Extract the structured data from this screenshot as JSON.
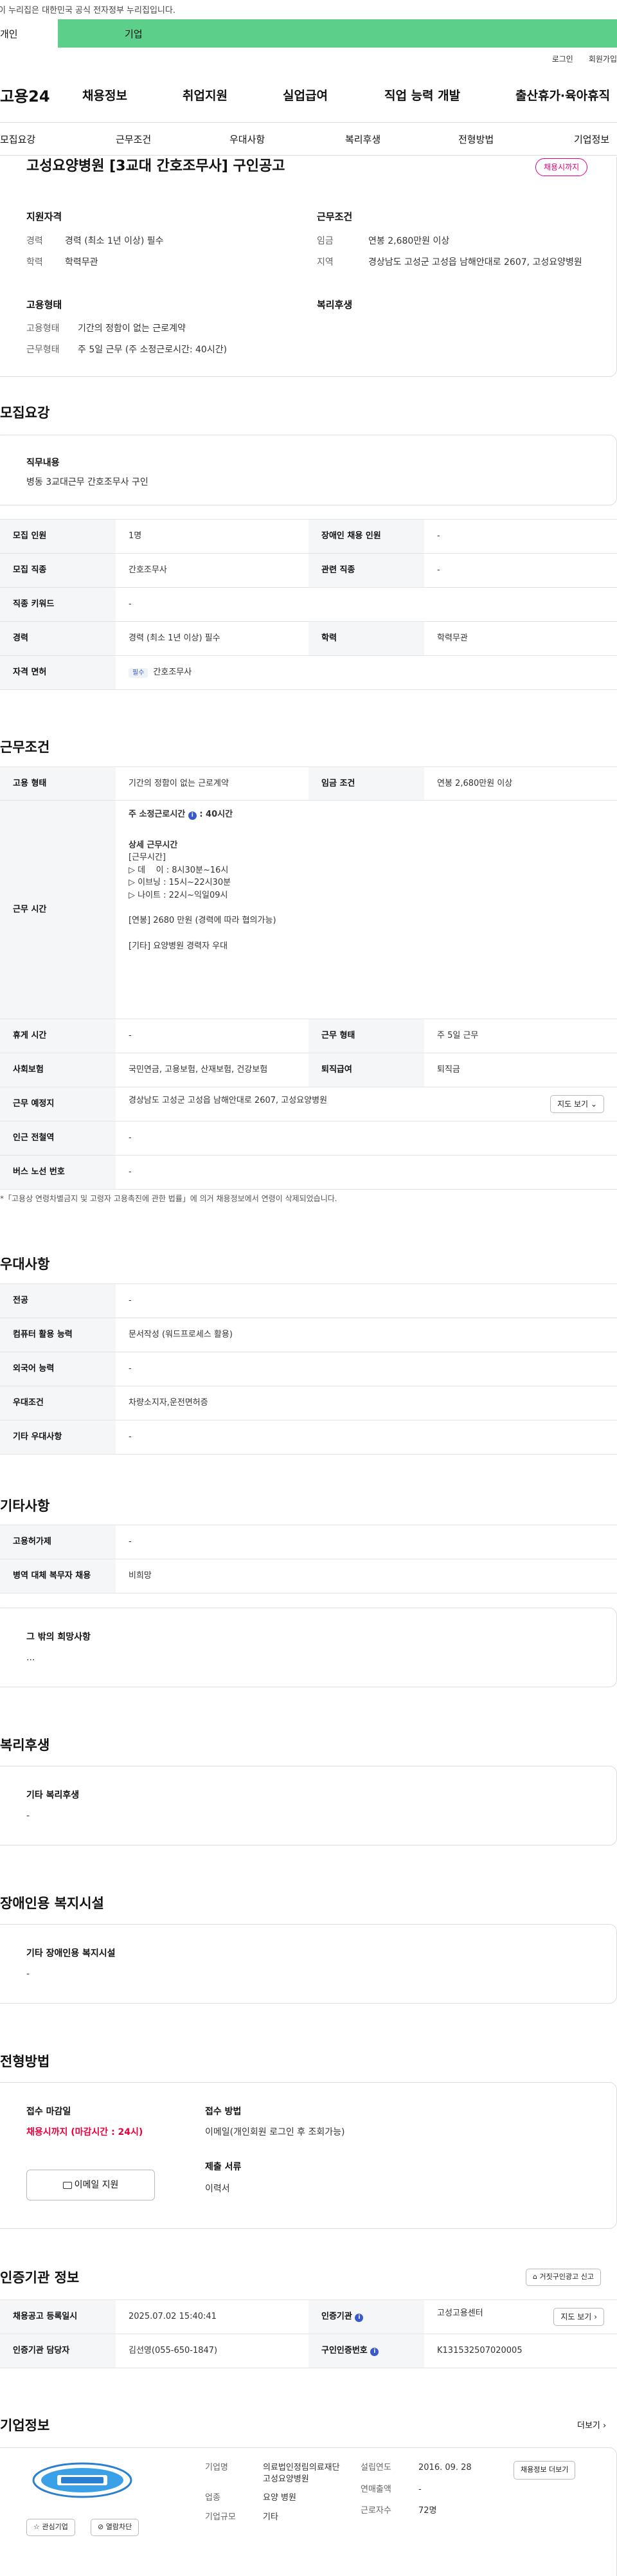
{
  "gov_banner": "이 누리집은 대한민국 공식 전자정부 누리집입니다.",
  "tabs": {
    "individual": "개인",
    "company": "기업"
  },
  "util": {
    "login": "로그인",
    "join": "회원가입"
  },
  "site": {
    "logo": "고용24"
  },
  "gnb": [
    "채용정보",
    "취업지원",
    "실업급여",
    "직업 능력 개발",
    "출산휴가·육아휴직"
  ],
  "anchors": [
    "모집요강",
    "근무조건",
    "우대사항",
    "복리후생",
    "전형방법",
    "기업정보"
  ],
  "job": {
    "title": "고성요양병원 [3교대 간호조무사] 구인공고",
    "status_badge": "채용시까지",
    "qual_title": "지원자격",
    "qual": [
      {
        "k": "경력",
        "v": "경력 (최소 1년 이상) 필수"
      },
      {
        "k": "학력",
        "v": "학력무관"
      }
    ],
    "emp_title": "고용형태",
    "emp": [
      {
        "k": "고용형태",
        "v": "기간의 정함이 없는 근로계약"
      },
      {
        "k": "근무형태",
        "v": "주 5일 근무 (주 소정근로시간: 40시간)"
      }
    ],
    "cond_title": "근무조건",
    "cond": [
      {
        "k": "임금",
        "v": "연봉 2,680만원 이상"
      },
      {
        "k": "지역",
        "v": "경상남도 고성군 고성읍 남해안대로 2607, 고성요양병원"
      }
    ],
    "welfare_title": "복리후생"
  },
  "recruit": {
    "title": "모집요강",
    "duty_label": "직무내용",
    "duty_text": "병동 3교대근무 간호조무사 구인",
    "rows": [
      [
        "모집 인원",
        "1명",
        "장애인 채용 인원",
        "-"
      ],
      [
        "모집 직종",
        "간호조무사",
        "관련 직종",
        "-"
      ],
      [
        "직종 키워드",
        "-"
      ],
      [
        "경력",
        "경력 (최소 1년 이상) 필수",
        "학력",
        "학력무관"
      ]
    ],
    "license_label": "자격 면허",
    "license_tag": "필수",
    "license_value": "간호조무사"
  },
  "work": {
    "title": "근무조건",
    "emp_type_label": "고용 형태",
    "emp_type": "기간의 정함이 없는 근로계약",
    "wage_label": "임금 조건",
    "wage": "연봉 2,680만원 이상",
    "hours_label": "근무 시간",
    "hours_main": "주 소정근로시간",
    "hours_main_value": ": 40시간",
    "hours_detail_title": "상세 근무시간",
    "hours_detail": [
      "[근무시간]",
      "▷ 데    이 : 8시30분~16시",
      "▷ 이브닝 : 15시~22시30분",
      "▷ 나이트 : 22시~익일09시",
      "",
      "[연봉] 2680 만원 (경력에 따라 협의가능)",
      "",
      "[기타] 요양병원 경력자 우대"
    ],
    "rows": [
      [
        "휴게 시간",
        "-",
        "근무 형태",
        "주 5일 근무"
      ],
      [
        "사회보험",
        "국민연금, 고용보험, 산재보험, 건강보험",
        "퇴직급여",
        "퇴직금"
      ]
    ],
    "place_label": "근무 예정지",
    "place": "경상남도 고성군 고성읍 남해안대로 2607, 고성요양병원",
    "map_button": "지도 보기",
    "subway_label": "인근 전철역",
    "subway": "-",
    "bus_label": "버스 노선 번호",
    "bus": "-",
    "note": "*「고용상 연령차별금지 및 고령자 고용촉진에 관한 법률」에 의거 채용정보에서 연령이 삭제되었습니다."
  },
  "pref": {
    "title": "우대사항",
    "rows": [
      [
        "전공",
        "-"
      ],
      [
        "컴퓨터 활용 능력",
        "문서작성 (워드프로세스 활용)"
      ],
      [
        "외국어 능력",
        "-"
      ],
      [
        "우대조건",
        "차량소지자,운전면허증"
      ],
      [
        "기타 우대사항",
        "-"
      ]
    ]
  },
  "etc": {
    "title": "기타사항",
    "rows": [
      [
        "고용허가제",
        "-"
      ],
      [
        "병역 대체 복무자 채용",
        "비희망"
      ]
    ],
    "other_label": "그 밖의 희망사항",
    "other_value": "..."
  },
  "welfare": {
    "title": "복리후생",
    "label": "기타 복리후생",
    "value": "-"
  },
  "disabled": {
    "title": "장애인용 복지시설",
    "label": "기타 장애인용 복지시설",
    "value": "-"
  },
  "apply": {
    "title": "전형방법",
    "deadline_label": "접수 마감일",
    "deadline": "채용시까지 (마감시간 : 24시)",
    "email_button": "이메일 지원",
    "method_label": "접수 방법",
    "method": "이메일(개인회원 로그인 후 조회가능)",
    "docs_label": "제출 서류",
    "docs": "이력서"
  },
  "cert": {
    "title": "인증기관 정보",
    "report_button": "거짓구인광고 신고",
    "rows": [
      [
        "채용공고 등록일시",
        "2025.07.02 15:40:41",
        "인증기관",
        "고성고용센터"
      ],
      [
        "인증기관 담당자",
        "김선영(055-650-1847)",
        "구인인증번호",
        "K131532507020005"
      ]
    ],
    "map_button": "지도 보기"
  },
  "company": {
    "title": "기업정보",
    "more": "더보기",
    "interest_button": "관심기업",
    "block_button": "열람차단",
    "fields": [
      {
        "k": "기업명",
        "v": "의료법인정림의료재단고성요양병원"
      },
      {
        "k": "업종",
        "v": "요양 병원"
      },
      {
        "k": "기업규모",
        "v": "기타"
      }
    ],
    "fields2": [
      {
        "k": "설립연도",
        "v": "2016. 09. 28"
      },
      {
        "k": "연매출액",
        "v": "-"
      },
      {
        "k": "근로자수",
        "v": "72명"
      }
    ],
    "info_button": "채용정보 더보기"
  }
}
